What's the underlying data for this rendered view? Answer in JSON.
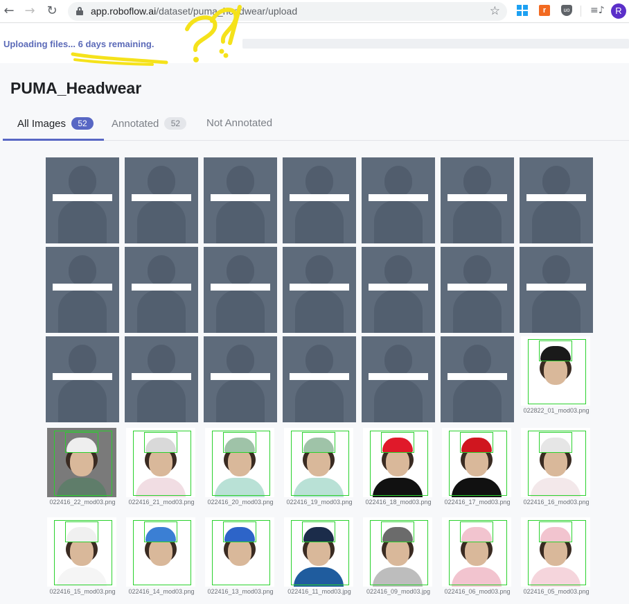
{
  "browser": {
    "url_host": "app.roboflow.ai",
    "url_path": "/dataset/puma_headwear/upload",
    "profile_initial": "R"
  },
  "upload": {
    "status_text": "Uploading files... 6 days remaining.",
    "progress_percent": 0,
    "annotation_scribble": "?!?"
  },
  "dataset": {
    "title": "PUMA_Headwear"
  },
  "tabs": [
    {
      "label": "All Images",
      "count": "52",
      "active": true
    },
    {
      "label": "Annotated",
      "count": "52",
      "active": false
    },
    {
      "label": "Not Annotated",
      "count": "",
      "active": false
    }
  ],
  "colors": {
    "accent": "#5867c4",
    "bbox": "#29d12c",
    "upload_overlay": "#6f7a86"
  },
  "uploading_count": 20,
  "images": [
    {
      "name": "022822_01_mod03.png",
      "cap": "#1a1a1a",
      "shirt": "#ffffff",
      "bg": "light"
    },
    {
      "name": "022416_22_mod03.png",
      "cap": "#eeeeee",
      "shirt": "#5f7d6a",
      "bg": "dark"
    },
    {
      "name": "022416_21_mod03.png",
      "cap": "#d9d9d9",
      "shirt": "#f1dde3",
      "bg": "light"
    },
    {
      "name": "022416_20_mod03.png",
      "cap": "#9fc3a8",
      "shirt": "#b9e1d6",
      "bg": "light"
    },
    {
      "name": "022416_19_mod03.png",
      "cap": "#9fc3a8",
      "shirt": "#b9e1d6",
      "bg": "light"
    },
    {
      "name": "022416_18_mod03.png",
      "cap": "#e0192a",
      "shirt": "#111111",
      "bg": "light"
    },
    {
      "name": "022416_17_mod03.png",
      "cap": "#d0161f",
      "shirt": "#111111",
      "bg": "light"
    },
    {
      "name": "022416_16_mod03.png",
      "cap": "#e6e6e6",
      "shirt": "#f3e8ea",
      "bg": "light"
    },
    {
      "name": "022416_15_mod03.png",
      "cap": "#f0f0f0",
      "shirt": "#f5f5f5",
      "bg": "light"
    },
    {
      "name": "022416_14_mod03.png",
      "cap": "#3b7fd4",
      "shirt": "#ffffff",
      "bg": "light"
    },
    {
      "name": "022416_13_mod03.png",
      "cap": "#2d64c8",
      "shirt": "#ffffff",
      "bg": "light"
    },
    {
      "name": "022416_11_mod03.jpg",
      "cap": "#1b2c4a",
      "shirt": "#1f5c9e",
      "bg": "light"
    },
    {
      "name": "022416_09_mod03.jpg",
      "cap": "#6b6b6b",
      "shirt": "#bdbdbd",
      "bg": "light"
    },
    {
      "name": "022416_06_mod03.png",
      "cap": "#f2c4cf",
      "shirt": "#f2c4cf",
      "bg": "light"
    },
    {
      "name": "022416_05_mod03.png",
      "cap": "#f2c4cf",
      "shirt": "#f5d5dc",
      "bg": "light"
    }
  ]
}
